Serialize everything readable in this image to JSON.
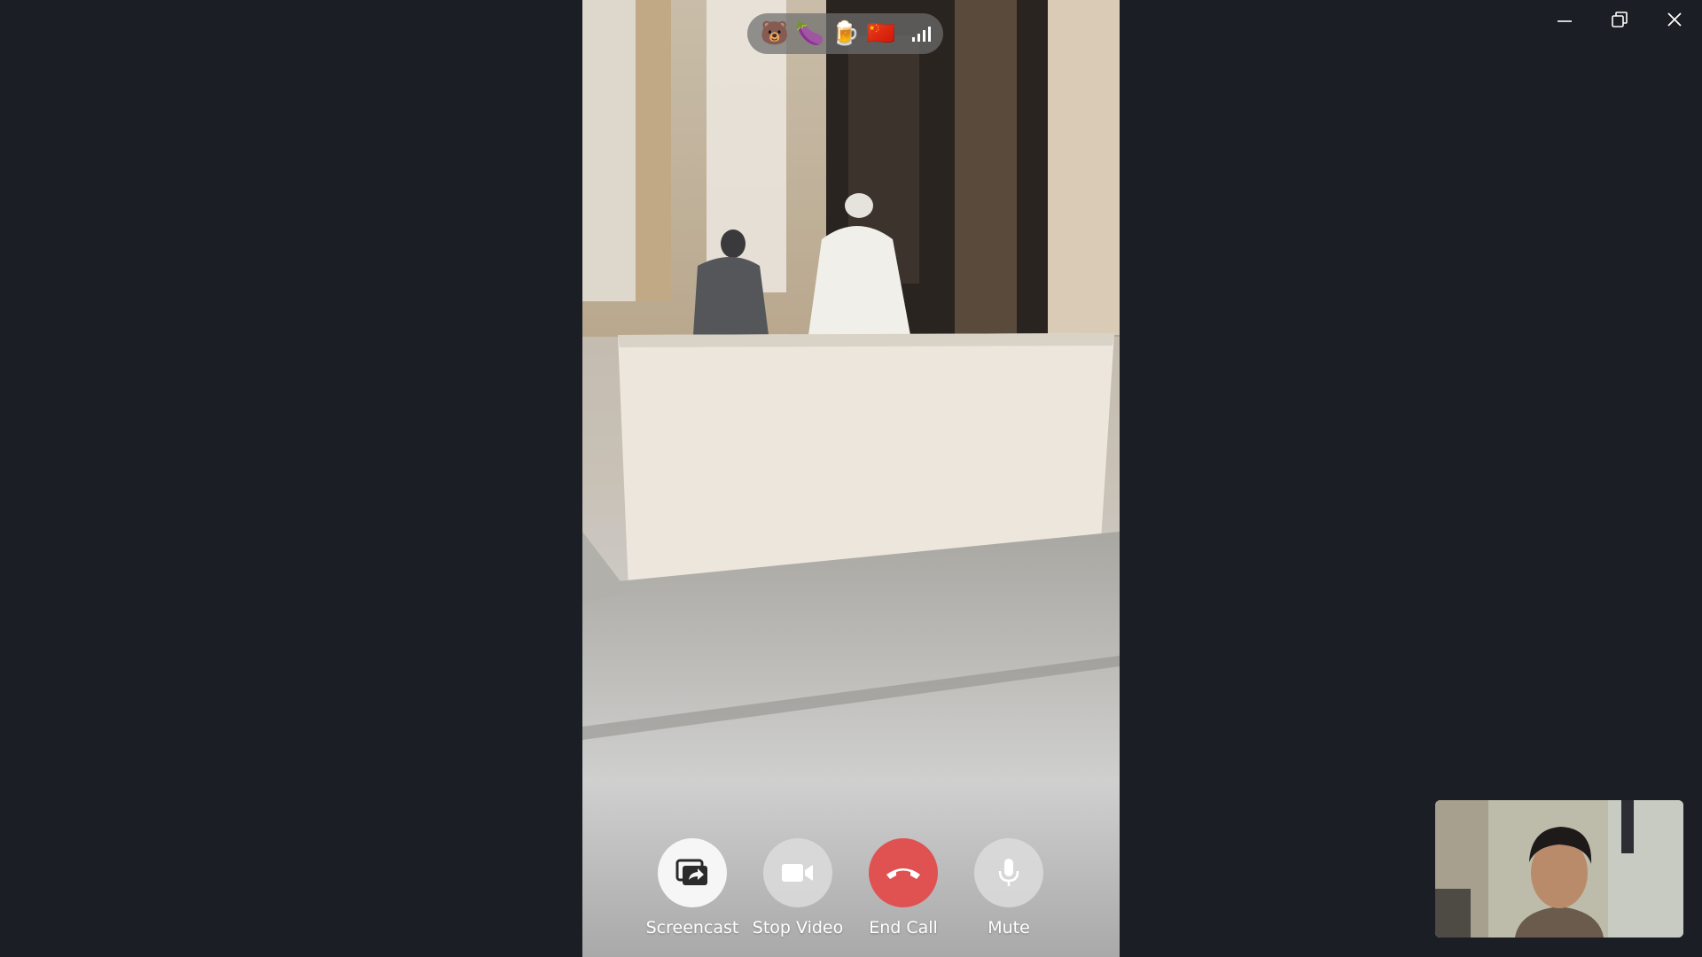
{
  "window": {
    "minimize_icon": "minimize-icon",
    "restore_icon": "restore-icon",
    "close_icon": "close-icon"
  },
  "info_bar": {
    "emojis": [
      "🐻",
      "🍆",
      "🍺",
      "🇨🇳"
    ],
    "signal_icon": "signal-strength-icon"
  },
  "controls": {
    "screencast": {
      "label": "Screencast",
      "icon": "screencast-icon"
    },
    "stop_video": {
      "label": "Stop Video",
      "icon": "video-camera-icon"
    },
    "end_call": {
      "label": "End Call",
      "icon": "phone-hangup-icon"
    },
    "mute": {
      "label": "Mute",
      "icon": "microphone-icon"
    }
  },
  "colors": {
    "background": "#1b1f25",
    "end_call": "#e05252",
    "control_light": "#f6f6f6"
  }
}
